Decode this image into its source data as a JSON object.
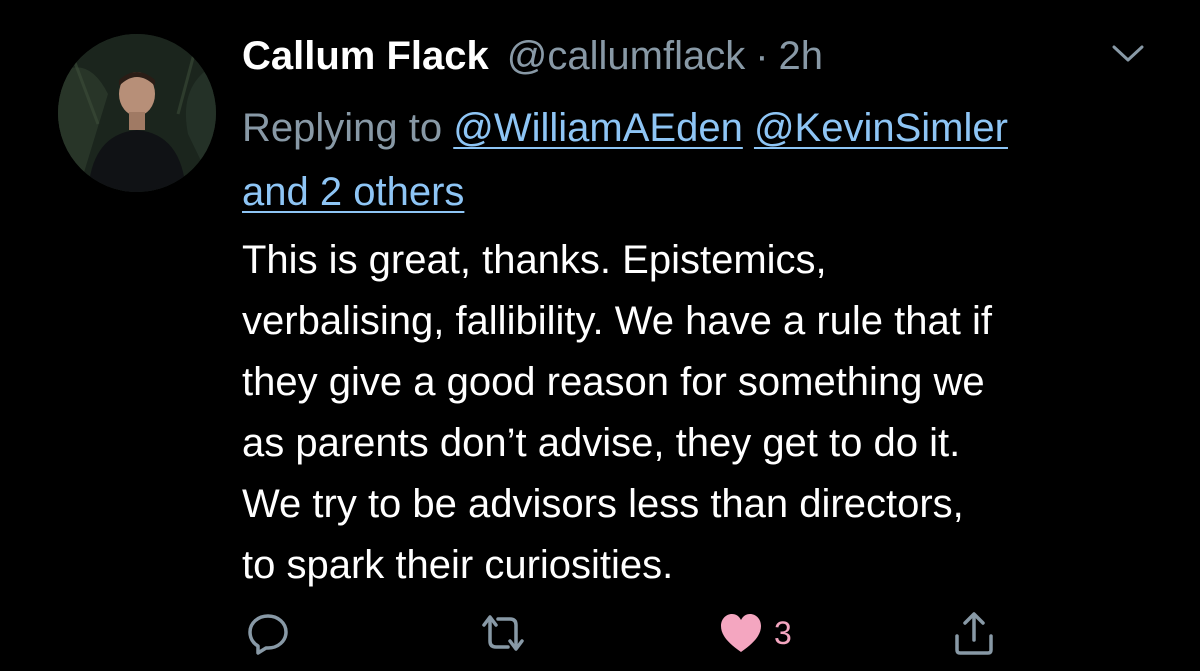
{
  "tweet": {
    "author": {
      "display_name": "Callum Flack",
      "handle": "@callumflack",
      "separator": "·",
      "timestamp": "2h"
    },
    "reply_to": {
      "prefix": "Replying to",
      "mentions": [
        "@WilliamAEden",
        "@KevinSimler"
      ],
      "others": "and 2 others"
    },
    "lines": [
      "This is great, thanks. Epistemics,",
      "verbalising, fallibility. We have a rule that if",
      "they give a good reason for something we",
      "as parents don’t advise, they get to do it.",
      "We try to be advisors less than directors,",
      "to spark their curiosities."
    ],
    "actions": {
      "like_count": "3"
    },
    "icons": {
      "menu": "chevron-down-icon",
      "reply": "reply-icon",
      "retweet": "retweet-icon",
      "like": "heart-icon",
      "share": "share-icon"
    },
    "colors": {
      "background": "#000000",
      "text": "#ffffff",
      "muted": "#8899a6",
      "link": "#8ec5f5",
      "like": "#f4a6c0"
    }
  }
}
